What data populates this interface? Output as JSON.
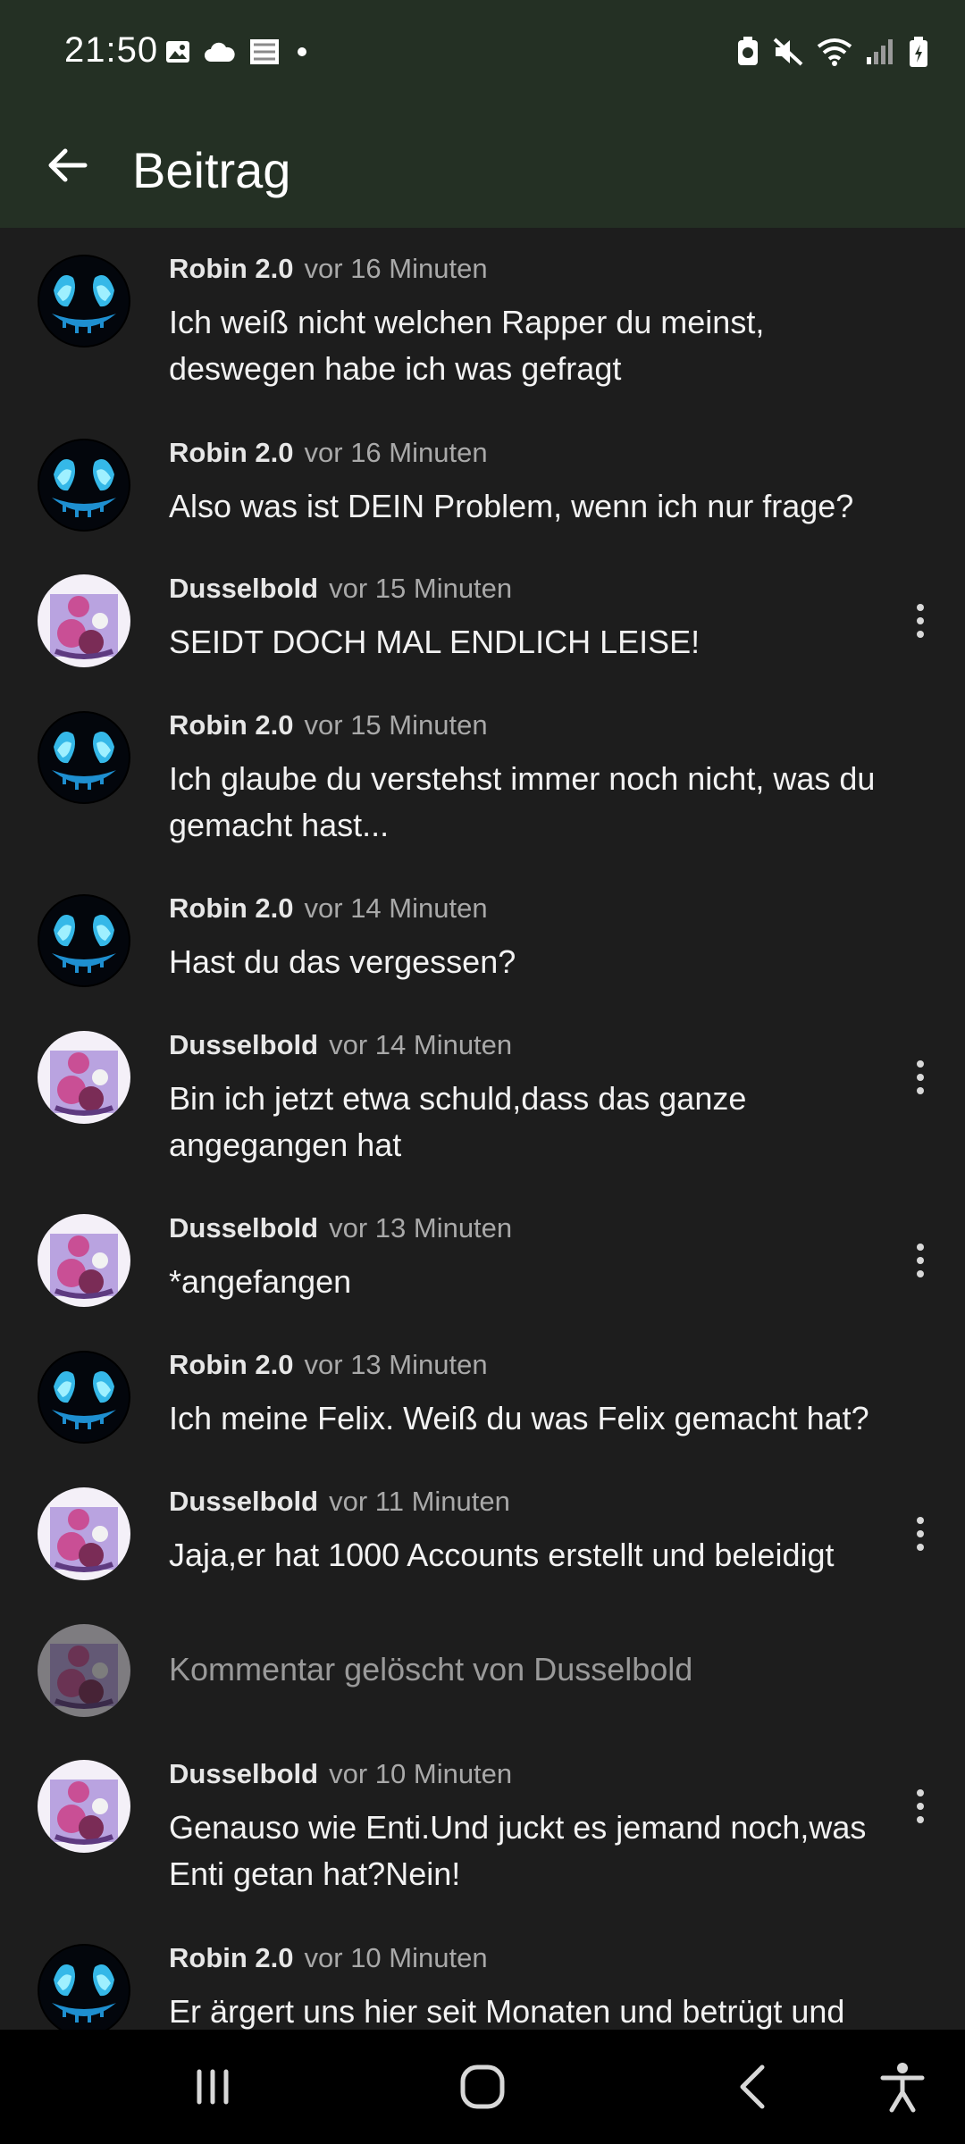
{
  "status_bar": {
    "time": "21:50",
    "left_icons": [
      "gallery-icon",
      "cloud-icon",
      "app-icon",
      "dot-icon"
    ],
    "right_icons": [
      "battery-saver-icon",
      "mute-icon",
      "wifi-icon",
      "signal-icon",
      "battery-charging-icon"
    ]
  },
  "app_bar": {
    "title": "Beitrag",
    "back_icon": "arrow-left-icon"
  },
  "comments": [
    {
      "author": "Robin 2.0",
      "time": "vor 16 Minuten",
      "lines": [
        "Ich weiß nicht welchen Rapper du meinst,",
        "deswegen habe ich was gefragt"
      ],
      "avatar": "robin",
      "menu": false
    },
    {
      "author": "Robin 2.0",
      "time": "vor 16 Minuten",
      "lines": [
        "Also was ist DEIN Problem, wenn ich nur frage?"
      ],
      "avatar": "robin",
      "menu": false
    },
    {
      "author": "Dusselbold",
      "time": "vor 15 Minuten",
      "lines": [
        "SEIDT DOCH MAL ENDLICH LEISE!"
      ],
      "avatar": "dussel",
      "menu": true
    },
    {
      "author": "Robin 2.0",
      "time": "vor 15 Minuten",
      "lines": [
        "Ich glaube du verstehst immer noch nicht, was du",
        "gemacht hast..."
      ],
      "avatar": "robin",
      "menu": false
    },
    {
      "author": "Robin 2.0",
      "time": "vor 14 Minuten",
      "lines": [
        "Hast du das vergessen?"
      ],
      "avatar": "robin",
      "menu": false
    },
    {
      "author": "Dusselbold",
      "time": "vor 14 Minuten",
      "lines": [
        "Bin ich jetzt etwa schuld,dass das ganze",
        "angegangen hat"
      ],
      "avatar": "dussel",
      "menu": true
    },
    {
      "author": "Dusselbold",
      "time": "vor 13 Minuten",
      "lines": [
        "*angefangen"
      ],
      "avatar": "dussel",
      "menu": true
    },
    {
      "author": "Robin 2.0",
      "time": "vor 13 Minuten",
      "lines": [
        "Ich meine Felix. Weiß du was Felix gemacht hat?"
      ],
      "avatar": "robin",
      "menu": false
    },
    {
      "author": "Dusselbold",
      "time": "vor 11 Minuten",
      "lines": [
        "Jaja,er hat 1000 Accounts erstellt und beleidigt"
      ],
      "avatar": "dussel",
      "menu": true
    },
    {
      "deleted": true,
      "text": "Kommentar gelöscht von Dusselbold",
      "avatar": "dussel"
    },
    {
      "author": "Dusselbold",
      "time": "vor 10 Minuten",
      "lines": [
        "Genauso wie Enti.Und juckt es jemand noch,was",
        "Enti getan hat?Nein!"
      ],
      "avatar": "dussel",
      "menu": true
    },
    {
      "author": "Robin 2.0",
      "time": "vor 10 Minuten",
      "lines": [
        "Er ärgert uns hier seit Monaten und betrügt und"
      ],
      "avatar": "robin",
      "menu": false
    }
  ],
  "nav_bar": {
    "buttons": [
      "recents-icon",
      "home-icon",
      "back-icon",
      "accessibility-icon"
    ]
  },
  "colors": {
    "header_bg": "#243024",
    "list_bg": "#1d1d1d",
    "nav_bg": "#000000"
  }
}
